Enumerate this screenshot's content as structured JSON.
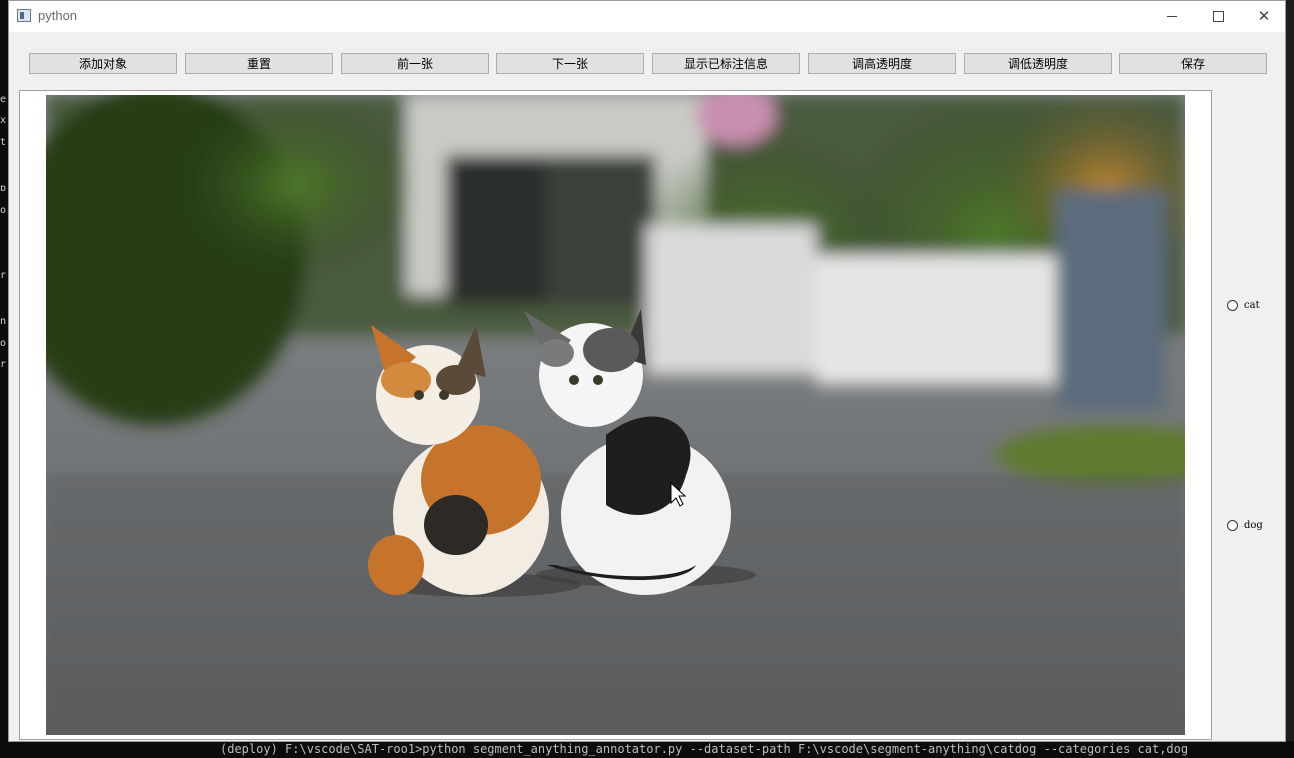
{
  "window": {
    "title": "python"
  },
  "toolbar": {
    "buttons": [
      {
        "label": "添加对象"
      },
      {
        "label": "重置"
      },
      {
        "label": "前一张"
      },
      {
        "label": "下一张"
      },
      {
        "label": "显示已标注信息"
      },
      {
        "label": "调高透明度"
      },
      {
        "label": "调低透明度"
      },
      {
        "label": "保存"
      }
    ]
  },
  "categories": [
    {
      "label": "cat"
    },
    {
      "label": "dog"
    }
  ],
  "image": {
    "alt": "two kittens sitting on a gravel path"
  },
  "terminal": {
    "command_line": "(deploy) F:\\vscode\\SAT-roo1>python segment_anything_annotator.py --dataset-path F:\\vscode\\segment-anything\\catdog --categories cat,dog"
  },
  "colors": {
    "window_bg": "#f0f0f0",
    "button_bg": "#e1e1e1",
    "button_border": "#adadad"
  }
}
